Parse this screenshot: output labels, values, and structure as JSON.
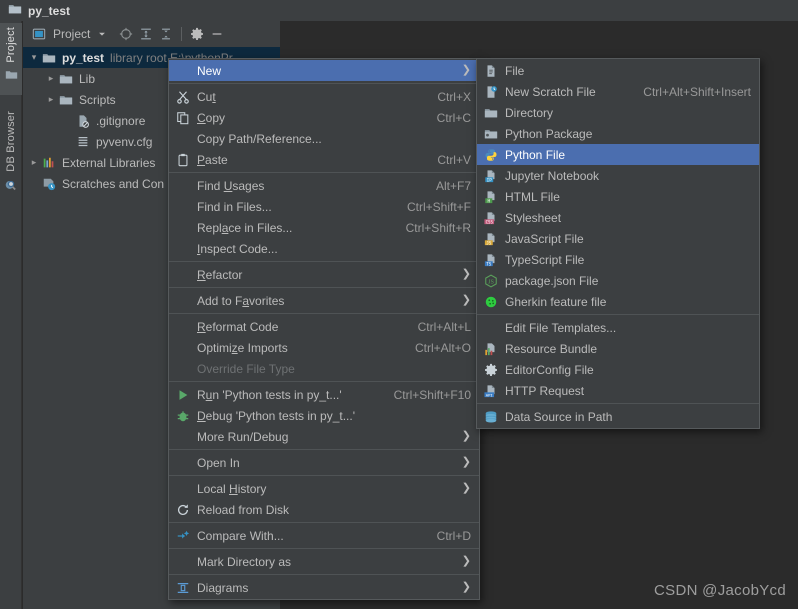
{
  "window": {
    "title": "py_test",
    "folder_icon": "folder-icon"
  },
  "toolstrip": {
    "buttons": [
      {
        "label": "Project",
        "icon": "project-panel-icon",
        "active": true
      },
      {
        "label": "DB Browser",
        "icon": "db-browser-icon",
        "active": false
      }
    ]
  },
  "project_panel": {
    "toolbar": {
      "title": "Project",
      "view_icon": "project-view-icon",
      "dropdown_icon": "chevron-down-icon",
      "locate_icon": "select-opened-file-icon",
      "expand_icon": "expand-all-icon",
      "collapse_icon": "collapse-all-icon",
      "settings_icon": "gear-icon",
      "hide_icon": "minimize-icon"
    },
    "tree": [
      {
        "name": "py_test",
        "sub": "library root  E:\\pythonPr",
        "icon": "folder-icon",
        "twisty": "expanded",
        "depth": 0,
        "selected": true,
        "bold": true
      },
      {
        "name": "Lib",
        "sub": "",
        "icon": "folder-icon",
        "twisty": "collapsed",
        "depth": 1,
        "selected": false,
        "bold": false
      },
      {
        "name": "Scripts",
        "sub": "",
        "icon": "folder-icon",
        "twisty": "collapsed",
        "depth": 1,
        "selected": false,
        "bold": false
      },
      {
        "name": ".gitignore",
        "sub": "",
        "icon": "gitignore-file-icon",
        "twisty": "none",
        "depth": 2,
        "selected": false,
        "bold": false
      },
      {
        "name": "pyvenv.cfg",
        "sub": "",
        "icon": "config-file-icon",
        "twisty": "none",
        "depth": 2,
        "selected": false,
        "bold": false
      },
      {
        "name": "External Libraries",
        "sub": "",
        "icon": "external-libraries-icon",
        "twisty": "collapsed",
        "depth": 0,
        "selected": false,
        "bold": false
      },
      {
        "name": "Scratches and Con",
        "sub": "",
        "icon": "scratches-icon",
        "twisty": "none",
        "depth": 0,
        "selected": false,
        "bold": false
      }
    ]
  },
  "context_menu": {
    "items": [
      {
        "label": "New",
        "accel": "",
        "icon": "",
        "arrow": true,
        "highlighted": true,
        "mnemonic": ""
      },
      {
        "sep": true
      },
      {
        "label": "Cut",
        "accel": "Ctrl+X",
        "icon": "cut-icon",
        "arrow": false,
        "mnemonic": "t"
      },
      {
        "label": "Copy",
        "accel": "Ctrl+C",
        "icon": "copy-icon",
        "arrow": false,
        "mnemonic": "C"
      },
      {
        "label": "Copy Path/Reference...",
        "accel": "",
        "icon": "",
        "arrow": false,
        "mnemonic": ""
      },
      {
        "label": "Paste",
        "accel": "Ctrl+V",
        "icon": "paste-icon",
        "arrow": false,
        "mnemonic": "P"
      },
      {
        "sep": true
      },
      {
        "label": "Find Usages",
        "accel": "Alt+F7",
        "icon": "",
        "arrow": false,
        "mnemonic": "U"
      },
      {
        "label": "Find in Files...",
        "accel": "Ctrl+Shift+F",
        "icon": "",
        "arrow": false,
        "mnemonic": ""
      },
      {
        "label": "Replace in Files...",
        "accel": "Ctrl+Shift+R",
        "icon": "",
        "arrow": false,
        "mnemonic": "a"
      },
      {
        "label": "Inspect Code...",
        "accel": "",
        "icon": "",
        "arrow": false,
        "mnemonic": "I"
      },
      {
        "sep": true
      },
      {
        "label": "Refactor",
        "accel": "",
        "icon": "",
        "arrow": true,
        "mnemonic": "R"
      },
      {
        "sep": true
      },
      {
        "label": "Add to Favorites",
        "accel": "",
        "icon": "",
        "arrow": true,
        "mnemonic": "a"
      },
      {
        "sep": true
      },
      {
        "label": "Reformat Code",
        "accel": "Ctrl+Alt+L",
        "icon": "",
        "arrow": false,
        "mnemonic": "R"
      },
      {
        "label": "Optimize Imports",
        "accel": "Ctrl+Alt+O",
        "icon": "",
        "arrow": false,
        "mnemonic": "z"
      },
      {
        "label": "Override File Type",
        "accel": "",
        "icon": "",
        "arrow": false,
        "disabled": true,
        "mnemonic": ""
      },
      {
        "sep": true
      },
      {
        "label": "Run 'Python tests in py_t...'",
        "accel": "Ctrl+Shift+F10",
        "icon": "run-icon",
        "arrow": false,
        "mnemonic": "u"
      },
      {
        "label": "Debug 'Python tests in py_t...'",
        "accel": "",
        "icon": "debug-icon",
        "arrow": false,
        "mnemonic": "D"
      },
      {
        "label": "More Run/Debug",
        "accel": "",
        "icon": "",
        "arrow": true,
        "mnemonic": ""
      },
      {
        "sep": true
      },
      {
        "label": "Open In",
        "accel": "",
        "icon": "",
        "arrow": true,
        "mnemonic": ""
      },
      {
        "sep": true
      },
      {
        "label": "Local History",
        "accel": "",
        "icon": "",
        "arrow": true,
        "mnemonic": "H"
      },
      {
        "label": "Reload from Disk",
        "accel": "",
        "icon": "reload-icon",
        "arrow": false,
        "mnemonic": ""
      },
      {
        "sep": true
      },
      {
        "label": "Compare With...",
        "accel": "Ctrl+D",
        "icon": "compare-icon",
        "arrow": false,
        "mnemonic": ""
      },
      {
        "sep": true
      },
      {
        "label": "Mark Directory as",
        "accel": "",
        "icon": "",
        "arrow": true,
        "mnemonic": ""
      },
      {
        "sep": true
      },
      {
        "label": "Diagrams",
        "accel": "",
        "icon": "diagrams-icon",
        "arrow": true,
        "mnemonic": ""
      }
    ]
  },
  "new_submenu": {
    "items": [
      {
        "label": "File",
        "accel": "",
        "icon": "file-icon",
        "highlighted": false
      },
      {
        "label": "New Scratch File",
        "accel": "Ctrl+Alt+Shift+Insert",
        "icon": "scratch-file-icon",
        "highlighted": false
      },
      {
        "label": "Directory",
        "accel": "",
        "icon": "folder-icon",
        "highlighted": false
      },
      {
        "label": "Python Package",
        "accel": "",
        "icon": "python-package-icon",
        "highlighted": false
      },
      {
        "label": "Python File",
        "accel": "",
        "icon": "python-file-icon",
        "highlighted": true
      },
      {
        "label": "Jupyter Notebook",
        "accel": "",
        "icon": "jupyter-notebook-icon",
        "highlighted": false
      },
      {
        "label": "HTML File",
        "accel": "",
        "icon": "html-file-icon",
        "highlighted": false
      },
      {
        "label": "Stylesheet",
        "accel": "",
        "icon": "css-file-icon",
        "highlighted": false
      },
      {
        "label": "JavaScript File",
        "accel": "",
        "icon": "javascript-file-icon",
        "highlighted": false
      },
      {
        "label": "TypeScript File",
        "accel": "",
        "icon": "typescript-file-icon",
        "highlighted": false
      },
      {
        "label": "package.json File",
        "accel": "",
        "icon": "nodejs-icon",
        "highlighted": false
      },
      {
        "label": "Gherkin feature file",
        "accel": "",
        "icon": "cucumber-icon",
        "highlighted": false
      },
      {
        "sep": true
      },
      {
        "label": "Edit File Templates...",
        "accel": "",
        "icon": "",
        "highlighted": false
      },
      {
        "label": "Resource Bundle",
        "accel": "",
        "icon": "resource-bundle-icon",
        "highlighted": false
      },
      {
        "label": "EditorConfig File",
        "accel": "",
        "icon": "gear-icon",
        "highlighted": false
      },
      {
        "label": "HTTP Request",
        "accel": "",
        "icon": "http-request-icon",
        "highlighted": false
      },
      {
        "sep": true
      },
      {
        "label": "Data Source in Path",
        "accel": "",
        "icon": "database-icon",
        "highlighted": false
      }
    ]
  },
  "watermark": {
    "text": "CSDN @JacobYcd"
  },
  "colors": {
    "accent_highlight": "#4b6eaf",
    "menu_bg": "#3c3f41",
    "editor_bg": "#2b2b2b",
    "tree_selected": "#0d293e",
    "text": "#bbbbbb"
  }
}
